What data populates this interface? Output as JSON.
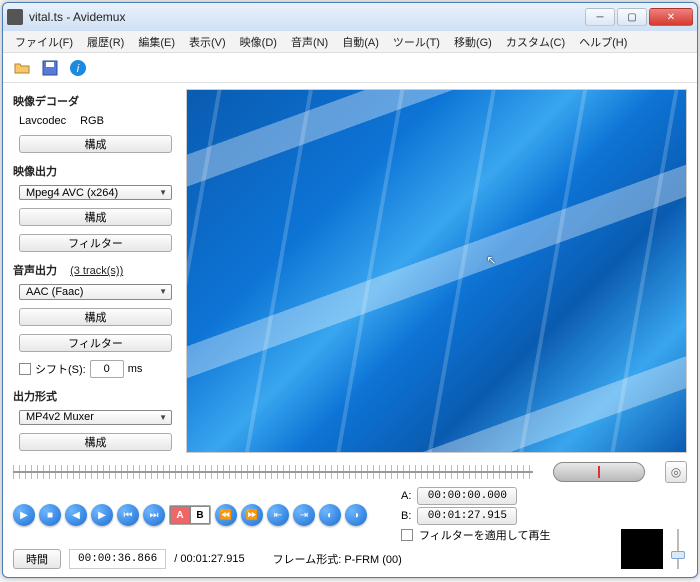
{
  "title": "vital.ts - Avidemux",
  "menu": {
    "file": "ファイル(F)",
    "recent": "履歴(R)",
    "edit": "編集(E)",
    "view": "表示(V)",
    "video": "映像(D)",
    "audio": "音声(N)",
    "auto": "自動(A)",
    "tools": "ツール(T)",
    "go": "移動(G)",
    "custom": "カスタム(C)",
    "help": "ヘルプ(H)"
  },
  "side": {
    "decoder_header": "映像デコーダ",
    "decoder_name": "Lavcodec",
    "decoder_color": "RGB",
    "video_out_header": "映像出力",
    "video_codec": "Mpeg4 AVC (x264)",
    "audio_out_header": "音声出力",
    "audio_tracks": "(3 track(s))",
    "audio_codec": "AAC (Faac)",
    "shift_label": "シフト(S):",
    "shift_value": "0",
    "shift_unit": "ms",
    "format_header": "出力形式",
    "format_value": "MP4v2 Muxer",
    "btn_configure": "構成",
    "btn_filter": "フィルター"
  },
  "ab": {
    "a_label": "A:",
    "b_label": "B:",
    "a_time": "00:00:00.000",
    "b_time": "00:01:27.915",
    "apply_filters": "フィルターを適用して再生"
  },
  "status": {
    "time_btn": "時間",
    "current": "00:00:36.866",
    "total": "/ 00:01:27.915",
    "frame_type": "フレーム形式: P-FRM (00)"
  },
  "markers": {
    "a": "A",
    "b": "B"
  }
}
